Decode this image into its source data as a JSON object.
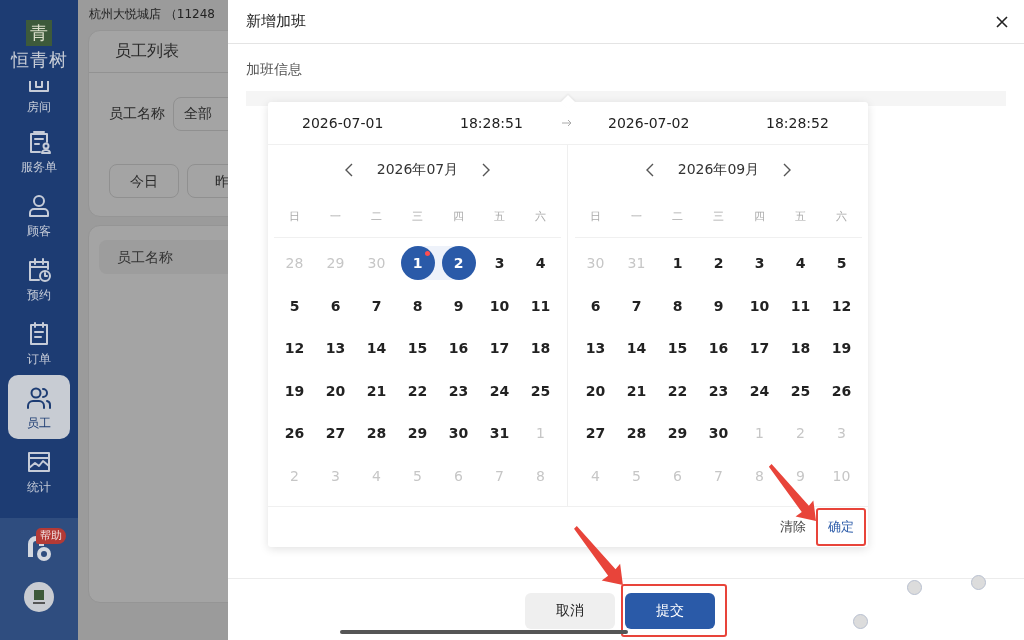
{
  "sidebar": {
    "logo": {
      "mark": "青",
      "text": "恒青树"
    },
    "items": [
      {
        "label": "房间",
        "selected": false
      },
      {
        "label": "服务单",
        "selected": false
      },
      {
        "label": "顾客",
        "selected": false
      },
      {
        "label": "预约",
        "selected": false
      },
      {
        "label": "订单",
        "selected": false
      },
      {
        "label": "员工",
        "selected": true
      },
      {
        "label": "统计",
        "selected": false
      }
    ],
    "help_badge": "帮助"
  },
  "background": {
    "store": "杭州大悦城店 （11248",
    "tabs": [
      "员工列表"
    ],
    "filter_label": "员工名称",
    "filter_value": "全部",
    "quick_buttons": [
      "今日",
      "昨"
    ],
    "table_header": "员工名称"
  },
  "drawer": {
    "title": "新增加班",
    "section": "加班信息",
    "picker": {
      "start_date": "2026-07-01",
      "start_time": "18:28:51",
      "end_date": "2026-07-02",
      "end_time": "18:28:52",
      "panels": [
        {
          "title": "2026年07月",
          "weekdays": [
            "日",
            "一",
            "二",
            "三",
            "四",
            "五",
            "六"
          ],
          "weeks": [
            [
              {
                "d": "28",
                "muted": true,
                "selected": false,
                "today": false
              },
              {
                "d": "29",
                "muted": true,
                "selected": false,
                "today": false
              },
              {
                "d": "30",
                "muted": true,
                "selected": false,
                "today": false
              },
              {
                "d": "1",
                "muted": false,
                "selected": true,
                "today": true
              },
              {
                "d": "2",
                "muted": false,
                "selected": true,
                "today": false
              },
              {
                "d": "3",
                "muted": false,
                "selected": false,
                "today": false
              },
              {
                "d": "4",
                "muted": false,
                "selected": false,
                "today": false
              }
            ],
            [
              {
                "d": "5",
                "muted": false,
                "selected": false,
                "today": false
              },
              {
                "d": "6",
                "muted": false,
                "selected": false,
                "today": false
              },
              {
                "d": "7",
                "muted": false,
                "selected": false,
                "today": false
              },
              {
                "d": "8",
                "muted": false,
                "selected": false,
                "today": false
              },
              {
                "d": "9",
                "muted": false,
                "selected": false,
                "today": false
              },
              {
                "d": "10",
                "muted": false,
                "selected": false,
                "today": false
              },
              {
                "d": "11",
                "muted": false,
                "selected": false,
                "today": false
              }
            ],
            [
              {
                "d": "12",
                "muted": false,
                "selected": false,
                "today": false
              },
              {
                "d": "13",
                "muted": false,
                "selected": false,
                "today": false
              },
              {
                "d": "14",
                "muted": false,
                "selected": false,
                "today": false
              },
              {
                "d": "15",
                "muted": false,
                "selected": false,
                "today": false
              },
              {
                "d": "16",
                "muted": false,
                "selected": false,
                "today": false
              },
              {
                "d": "17",
                "muted": false,
                "selected": false,
                "today": false
              },
              {
                "d": "18",
                "muted": false,
                "selected": false,
                "today": false
              }
            ],
            [
              {
                "d": "19",
                "muted": false,
                "selected": false,
                "today": false
              },
              {
                "d": "20",
                "muted": false,
                "selected": false,
                "today": false
              },
              {
                "d": "21",
                "muted": false,
                "selected": false,
                "today": false
              },
              {
                "d": "22",
                "muted": false,
                "selected": false,
                "today": false
              },
              {
                "d": "23",
                "muted": false,
                "selected": false,
                "today": false
              },
              {
                "d": "24",
                "muted": false,
                "selected": false,
                "today": false
              },
              {
                "d": "25",
                "muted": false,
                "selected": false,
                "today": false
              }
            ],
            [
              {
                "d": "26",
                "muted": false,
                "selected": false,
                "today": false
              },
              {
                "d": "27",
                "muted": false,
                "selected": false,
                "today": false
              },
              {
                "d": "28",
                "muted": false,
                "selected": false,
                "today": false
              },
              {
                "d": "29",
                "muted": false,
                "selected": false,
                "today": false
              },
              {
                "d": "30",
                "muted": false,
                "selected": false,
                "today": false
              },
              {
                "d": "31",
                "muted": false,
                "selected": false,
                "today": false
              },
              {
                "d": "1",
                "muted": true,
                "selected": false,
                "today": false
              }
            ],
            [
              {
                "d": "2",
                "muted": true,
                "selected": false,
                "today": false
              },
              {
                "d": "3",
                "muted": true,
                "selected": false,
                "today": false
              },
              {
                "d": "4",
                "muted": true,
                "selected": false,
                "today": false
              },
              {
                "d": "5",
                "muted": true,
                "selected": false,
                "today": false
              },
              {
                "d": "6",
                "muted": true,
                "selected": false,
                "today": false
              },
              {
                "d": "7",
                "muted": true,
                "selected": false,
                "today": false
              },
              {
                "d": "8",
                "muted": true,
                "selected": false,
                "today": false
              }
            ]
          ]
        },
        {
          "title": "2026年09月",
          "weekdays": [
            "日",
            "一",
            "二",
            "三",
            "四",
            "五",
            "六"
          ],
          "weeks": [
            [
              {
                "d": "30",
                "muted": true,
                "selected": false,
                "today": false
              },
              {
                "d": "31",
                "muted": true,
                "selected": false,
                "today": false
              },
              {
                "d": "1",
                "muted": false,
                "selected": false,
                "today": false
              },
              {
                "d": "2",
                "muted": false,
                "selected": false,
                "today": false
              },
              {
                "d": "3",
                "muted": false,
                "selected": false,
                "today": false
              },
              {
                "d": "4",
                "muted": false,
                "selected": false,
                "today": false
              },
              {
                "d": "5",
                "muted": false,
                "selected": false,
                "today": false
              }
            ],
            [
              {
                "d": "6",
                "muted": false,
                "selected": false,
                "today": false
              },
              {
                "d": "7",
                "muted": false,
                "selected": false,
                "today": false
              },
              {
                "d": "8",
                "muted": false,
                "selected": false,
                "today": false
              },
              {
                "d": "9",
                "muted": false,
                "selected": false,
                "today": false
              },
              {
                "d": "10",
                "muted": false,
                "selected": false,
                "today": false
              },
              {
                "d": "11",
                "muted": false,
                "selected": false,
                "today": false
              },
              {
                "d": "12",
                "muted": false,
                "selected": false,
                "today": false
              }
            ],
            [
              {
                "d": "13",
                "muted": false,
                "selected": false,
                "today": false
              },
              {
                "d": "14",
                "muted": false,
                "selected": false,
                "today": false
              },
              {
                "d": "15",
                "muted": false,
                "selected": false,
                "today": false
              },
              {
                "d": "16",
                "muted": false,
                "selected": false,
                "today": false
              },
              {
                "d": "17",
                "muted": false,
                "selected": false,
                "today": false
              },
              {
                "d": "18",
                "muted": false,
                "selected": false,
                "today": false
              },
              {
                "d": "19",
                "muted": false,
                "selected": false,
                "today": false
              }
            ],
            [
              {
                "d": "20",
                "muted": false,
                "selected": false,
                "today": false
              },
              {
                "d": "21",
                "muted": false,
                "selected": false,
                "today": false
              },
              {
                "d": "22",
                "muted": false,
                "selected": false,
                "today": false
              },
              {
                "d": "23",
                "muted": false,
                "selected": false,
                "today": false
              },
              {
                "d": "24",
                "muted": false,
                "selected": false,
                "today": false
              },
              {
                "d": "25",
                "muted": false,
                "selected": false,
                "today": false
              },
              {
                "d": "26",
                "muted": false,
                "selected": false,
                "today": false
              }
            ],
            [
              {
                "d": "27",
                "muted": false,
                "selected": false,
                "today": false
              },
              {
                "d": "28",
                "muted": false,
                "selected": false,
                "today": false
              },
              {
                "d": "29",
                "muted": false,
                "selected": false,
                "today": false
              },
              {
                "d": "30",
                "muted": false,
                "selected": false,
                "today": false
              },
              {
                "d": "1",
                "muted": true,
                "selected": false,
                "today": false
              },
              {
                "d": "2",
                "muted": true,
                "selected": false,
                "today": false
              },
              {
                "d": "3",
                "muted": true,
                "selected": false,
                "today": false
              }
            ],
            [
              {
                "d": "4",
                "muted": true,
                "selected": false,
                "today": false
              },
              {
                "d": "5",
                "muted": true,
                "selected": false,
                "today": false
              },
              {
                "d": "6",
                "muted": true,
                "selected": false,
                "today": false
              },
              {
                "d": "7",
                "muted": true,
                "selected": false,
                "today": false
              },
              {
                "d": "8",
                "muted": true,
                "selected": false,
                "today": false
              },
              {
                "d": "9",
                "muted": true,
                "selected": false,
                "today": false
              },
              {
                "d": "10",
                "muted": true,
                "selected": false,
                "today": false
              }
            ]
          ]
        }
      ],
      "clear": "清除",
      "confirm": {
        "label": "确定",
        "highlighted": true
      }
    },
    "buttons": [
      {
        "label": "取消",
        "kind": "secondary",
        "highlighted": false
      },
      {
        "label": "提交",
        "kind": "primary",
        "highlighted": true
      }
    ]
  }
}
